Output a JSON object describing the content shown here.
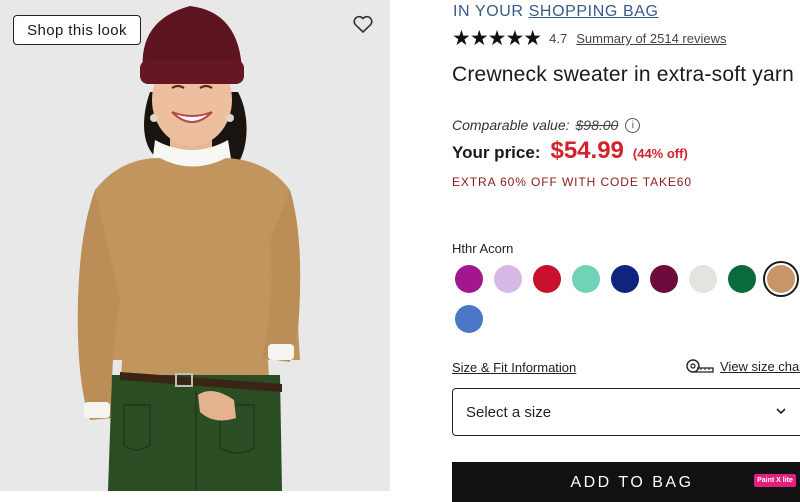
{
  "image_panel": {
    "shop_look_label": "Shop this look",
    "favorite_icon": "heart-icon"
  },
  "product": {
    "bag_prefix": "IN YOUR",
    "bag_link": "SHOPPING BAG",
    "stars": "★★★★★",
    "rating": "4.7",
    "reviews_link": "Summary of 2514 reviews",
    "title": "Crewneck sweater in extra-soft yarn",
    "compare_label": "Comparable value:",
    "compare_price": "$98.00",
    "info_icon": "i",
    "price_label": "Your price:",
    "price": "$54.99",
    "discount": "(44% off)",
    "promo": "EXTRA 60% OFF WITH CODE TAKE60",
    "accent_color": "#d3222a"
  },
  "colors": {
    "selected_name": "Hthr Acorn",
    "swatches": [
      {
        "name": "magenta",
        "color": "#a3178c"
      },
      {
        "name": "lilac",
        "color": "#d8b8e4"
      },
      {
        "name": "red",
        "color": "#c8102e"
      },
      {
        "name": "mint",
        "color": "#6fd3b8"
      },
      {
        "name": "navy",
        "color": "#0f237f"
      },
      {
        "name": "burgundy",
        "color": "#6e0a3c"
      },
      {
        "name": "light heather gray",
        "color": "#e5e3df"
      },
      {
        "name": "green",
        "color": "#0a6a3c"
      },
      {
        "name": "Hthr Acorn",
        "color": "#c79568",
        "selected": true
      },
      {
        "name": "cornflower blue",
        "color": "#4a78c6"
      }
    ]
  },
  "sizing": {
    "size_fit_link": "Size & Fit Information",
    "size_chart_link": "View size chart",
    "size_chart_icon": "measuring-tape-icon",
    "select_label": "Select a size",
    "select_icon": "chevron-down-icon"
  },
  "actions": {
    "add_to_bag": "ADD TO BAG"
  },
  "overlay_badge": "Paint X lite"
}
